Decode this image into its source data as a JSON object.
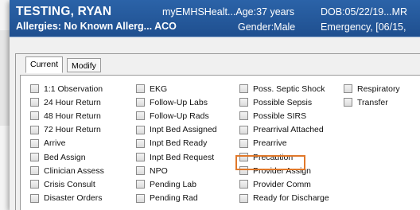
{
  "banner": {
    "patient_name": "TESTING, RYAN",
    "allergies": "Allergies: No Known Allerg... ACO",
    "app_age": "myEMHSHealt...Age:37 years",
    "gender": "Gender:Male",
    "dob": "DOB:05/22/19...MR",
    "encounter": "Emergency, [06/15,"
  },
  "tabs": {
    "current": "Current",
    "modify": "Modify"
  },
  "columns": [
    [
      "1:1 Observation",
      "24 Hour Return",
      "48 Hour Return",
      "72 Hour Return",
      "Arrive",
      "Bed Assign",
      "Clinician Assess",
      "Crisis Consult",
      "Disaster Orders"
    ],
    [
      "EKG",
      "Follow-Up Labs",
      "Follow-Up Rads",
      "Inpt Bed Assigned",
      "Inpt Bed Ready",
      "Inpt Bed Request",
      "NPO",
      "Pending Lab",
      "Pending Rad"
    ],
    [
      "Poss. Septic Shock",
      "Possible Sepsis",
      "Possible SIRS",
      "Prearrival Attached",
      "Prearrive",
      "Precaution",
      "Provider Assign",
      "Provider Comm",
      "Ready for Discharge"
    ],
    [
      "Respiratory",
      "Transfer"
    ]
  ],
  "highlighted_item": "Precaution",
  "colors": {
    "banner": "#1f4f8f",
    "highlight": "#e0782a"
  }
}
